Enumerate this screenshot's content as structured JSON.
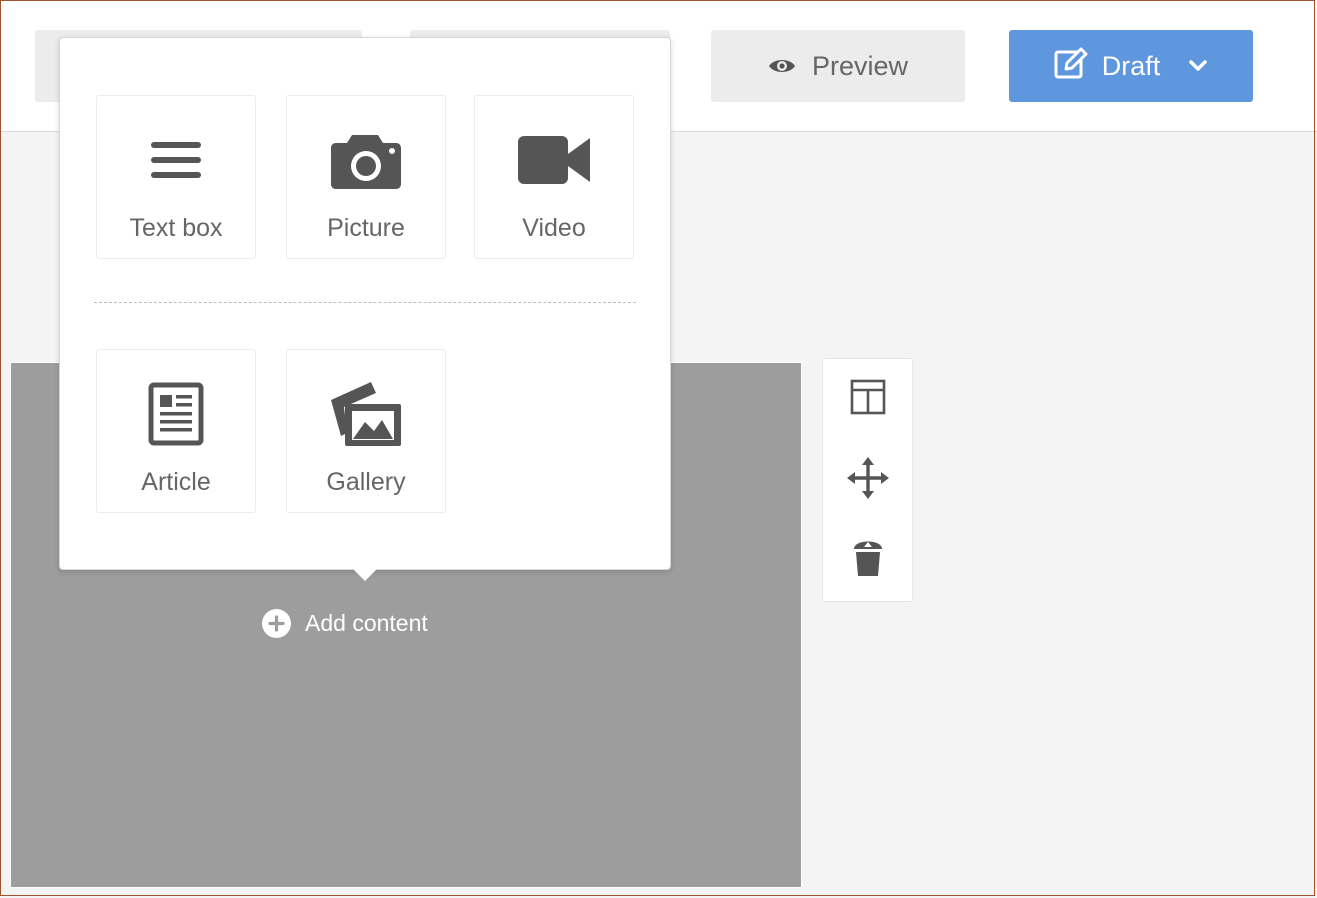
{
  "header": {
    "preview_label": "Preview",
    "draft_label": "Draft"
  },
  "add_menu": {
    "items": [
      {
        "label": "Text box",
        "icon": "text-lines-icon"
      },
      {
        "label": "Picture",
        "icon": "camera-icon"
      },
      {
        "label": "Video",
        "icon": "video-camera-icon"
      },
      {
        "label": "Article",
        "icon": "article-icon"
      },
      {
        "label": "Gallery",
        "icon": "gallery-icon"
      }
    ]
  },
  "block": {
    "add_content_label": "Add content"
  },
  "block_tools": [
    {
      "icon": "layout-icon"
    },
    {
      "icon": "move-icon"
    },
    {
      "icon": "trash-icon"
    }
  ],
  "colors": {
    "accent": "#5e97dd",
    "block_bg": "#9d9d9d",
    "canvas_bg": "#f4f4f4",
    "icon": "#555555"
  }
}
